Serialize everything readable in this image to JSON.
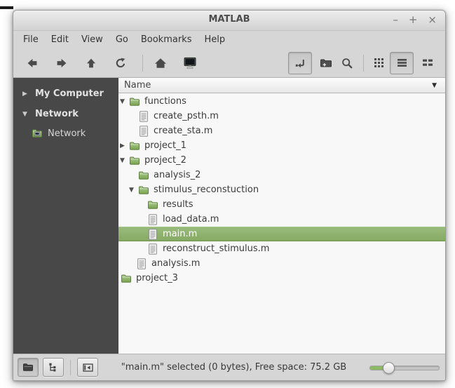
{
  "window": {
    "title": "MATLAB",
    "controls": {
      "minimize": "–",
      "maximize": "+",
      "close": "×"
    }
  },
  "menubar": {
    "items": [
      "File",
      "Edit",
      "View",
      "Go",
      "Bookmarks",
      "Help"
    ]
  },
  "toolbar": {
    "left_buttons": [
      {
        "icon": "back-arrow"
      },
      {
        "icon": "forward-arrow"
      },
      {
        "icon": "up-arrow"
      },
      {
        "icon": "refresh"
      },
      {
        "icon": "home"
      },
      {
        "icon": "computer"
      }
    ],
    "right_buttons": [
      {
        "icon": "toggle-location-entry",
        "pressed": true
      },
      {
        "icon": "new-folder",
        "pressed": false
      },
      {
        "icon": "search",
        "pressed": false
      },
      {
        "icon": "icon-view",
        "pressed": false
      },
      {
        "icon": "list-view",
        "pressed": true
      },
      {
        "icon": "compact-view",
        "pressed": false
      }
    ]
  },
  "sidebar": {
    "items": [
      {
        "label": "My Computer",
        "expander": "collapsed"
      },
      {
        "label": "Network",
        "expander": "expanded"
      },
      {
        "label": "Network",
        "icon": "network-folder"
      }
    ]
  },
  "filelist": {
    "header": "Name",
    "rows": [
      {
        "label": "functions",
        "icon": "folder",
        "expander": "expanded",
        "depth": 0
      },
      {
        "label": "create_psth.m",
        "icon": "file",
        "depth": 1
      },
      {
        "label": "create_sta.m",
        "icon": "file",
        "depth": 1
      },
      {
        "label": "project_1",
        "icon": "folder",
        "expander": "collapsed",
        "depth": 0
      },
      {
        "label": "project_2",
        "icon": "folder",
        "expander": "expanded",
        "depth": 0
      },
      {
        "label": "analysis_2",
        "icon": "folder",
        "depth": 1
      },
      {
        "label": "stimulus_reconstuction",
        "icon": "folder",
        "expander": "expanded",
        "depth": 1
      },
      {
        "label": "results",
        "icon": "folder",
        "depth": 2
      },
      {
        "label": "load_data.m",
        "icon": "file",
        "depth": 2
      },
      {
        "label": "main.m",
        "icon": "file",
        "depth": 2,
        "selected": true
      },
      {
        "label": "reconstruct_stimulus.m",
        "icon": "file",
        "depth": 2
      },
      {
        "label": "analysis.m",
        "icon": "file",
        "depth": 1
      },
      {
        "label": "project_3",
        "icon": "folder",
        "depth": 0
      }
    ],
    "expander_glyphs": {
      "expanded": "▼",
      "collapsed": "▶"
    }
  },
  "statusbar": {
    "buttons": [
      {
        "icon": "places",
        "pressed": true
      },
      {
        "icon": "treeview",
        "pressed": false
      },
      {
        "icon": "toggle-sidebar",
        "pressed": false
      }
    ],
    "text": "\"main.m\" selected (0 bytes), Free space: 75.2 GB",
    "zoom_slider_pct": 27
  },
  "colors": {
    "selection_green": "#8fb56e",
    "sidebar_bg": "#484848",
    "chrome_gray": "#d6d6d6",
    "pane_bg": "#f8f8f8",
    "folder_green": "#8bb562"
  }
}
